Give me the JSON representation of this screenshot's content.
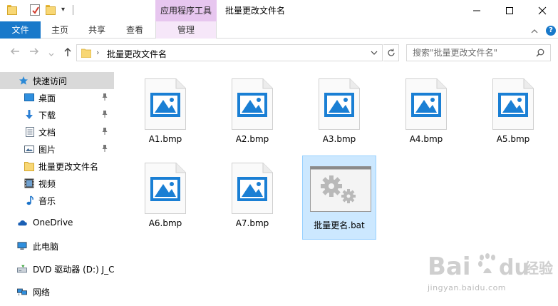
{
  "window": {
    "title": "批量更改文件名",
    "context_group": "应用程序工具"
  },
  "ribbon": {
    "tabs": [
      {
        "label": "文件"
      },
      {
        "label": "主页"
      },
      {
        "label": "共享"
      },
      {
        "label": "查看"
      },
      {
        "label": "管理"
      }
    ],
    "help_label": "?"
  },
  "address": {
    "crumb": "批量更改文件名",
    "search_placeholder": "搜索\"批量更改文件名\""
  },
  "sidebar": {
    "items": [
      {
        "label": "快速访问",
        "icon": "star-icon"
      },
      {
        "label": "桌面",
        "icon": "desktop-icon"
      },
      {
        "label": "下载",
        "icon": "download-icon"
      },
      {
        "label": "文档",
        "icon": "document-icon"
      },
      {
        "label": "图片",
        "icon": "picture-icon"
      },
      {
        "label": "批量更改文件名",
        "icon": "folder-icon"
      },
      {
        "label": "视频",
        "icon": "video-icon"
      },
      {
        "label": "音乐",
        "icon": "music-icon"
      },
      {
        "label": "OneDrive",
        "icon": "cloud-icon"
      },
      {
        "label": "此电脑",
        "icon": "computer-icon"
      },
      {
        "label": "DVD 驱动器 (D:) J_C",
        "icon": "dvd-icon"
      },
      {
        "label": "网络",
        "icon": "network-icon"
      }
    ]
  },
  "files": [
    {
      "name": "A1.bmp",
      "type": "image"
    },
    {
      "name": "A2.bmp",
      "type": "image"
    },
    {
      "name": "A3.bmp",
      "type": "image"
    },
    {
      "name": "A4.bmp",
      "type": "image"
    },
    {
      "name": "A5.bmp",
      "type": "image"
    },
    {
      "name": "A6.bmp",
      "type": "image"
    },
    {
      "name": "A7.bmp",
      "type": "image"
    },
    {
      "name": "批量更名.bat",
      "type": "batch",
      "selected": true
    }
  ],
  "watermark": {
    "brand": "Bai",
    "brand2": "du",
    "cn": "经验",
    "url": "jingyan.baidu.com"
  },
  "colors": {
    "accent": "#1979ca",
    "context_tab": "#e7c6ef",
    "selection": "#cce8ff",
    "image_icon": "#1a7fd4"
  }
}
